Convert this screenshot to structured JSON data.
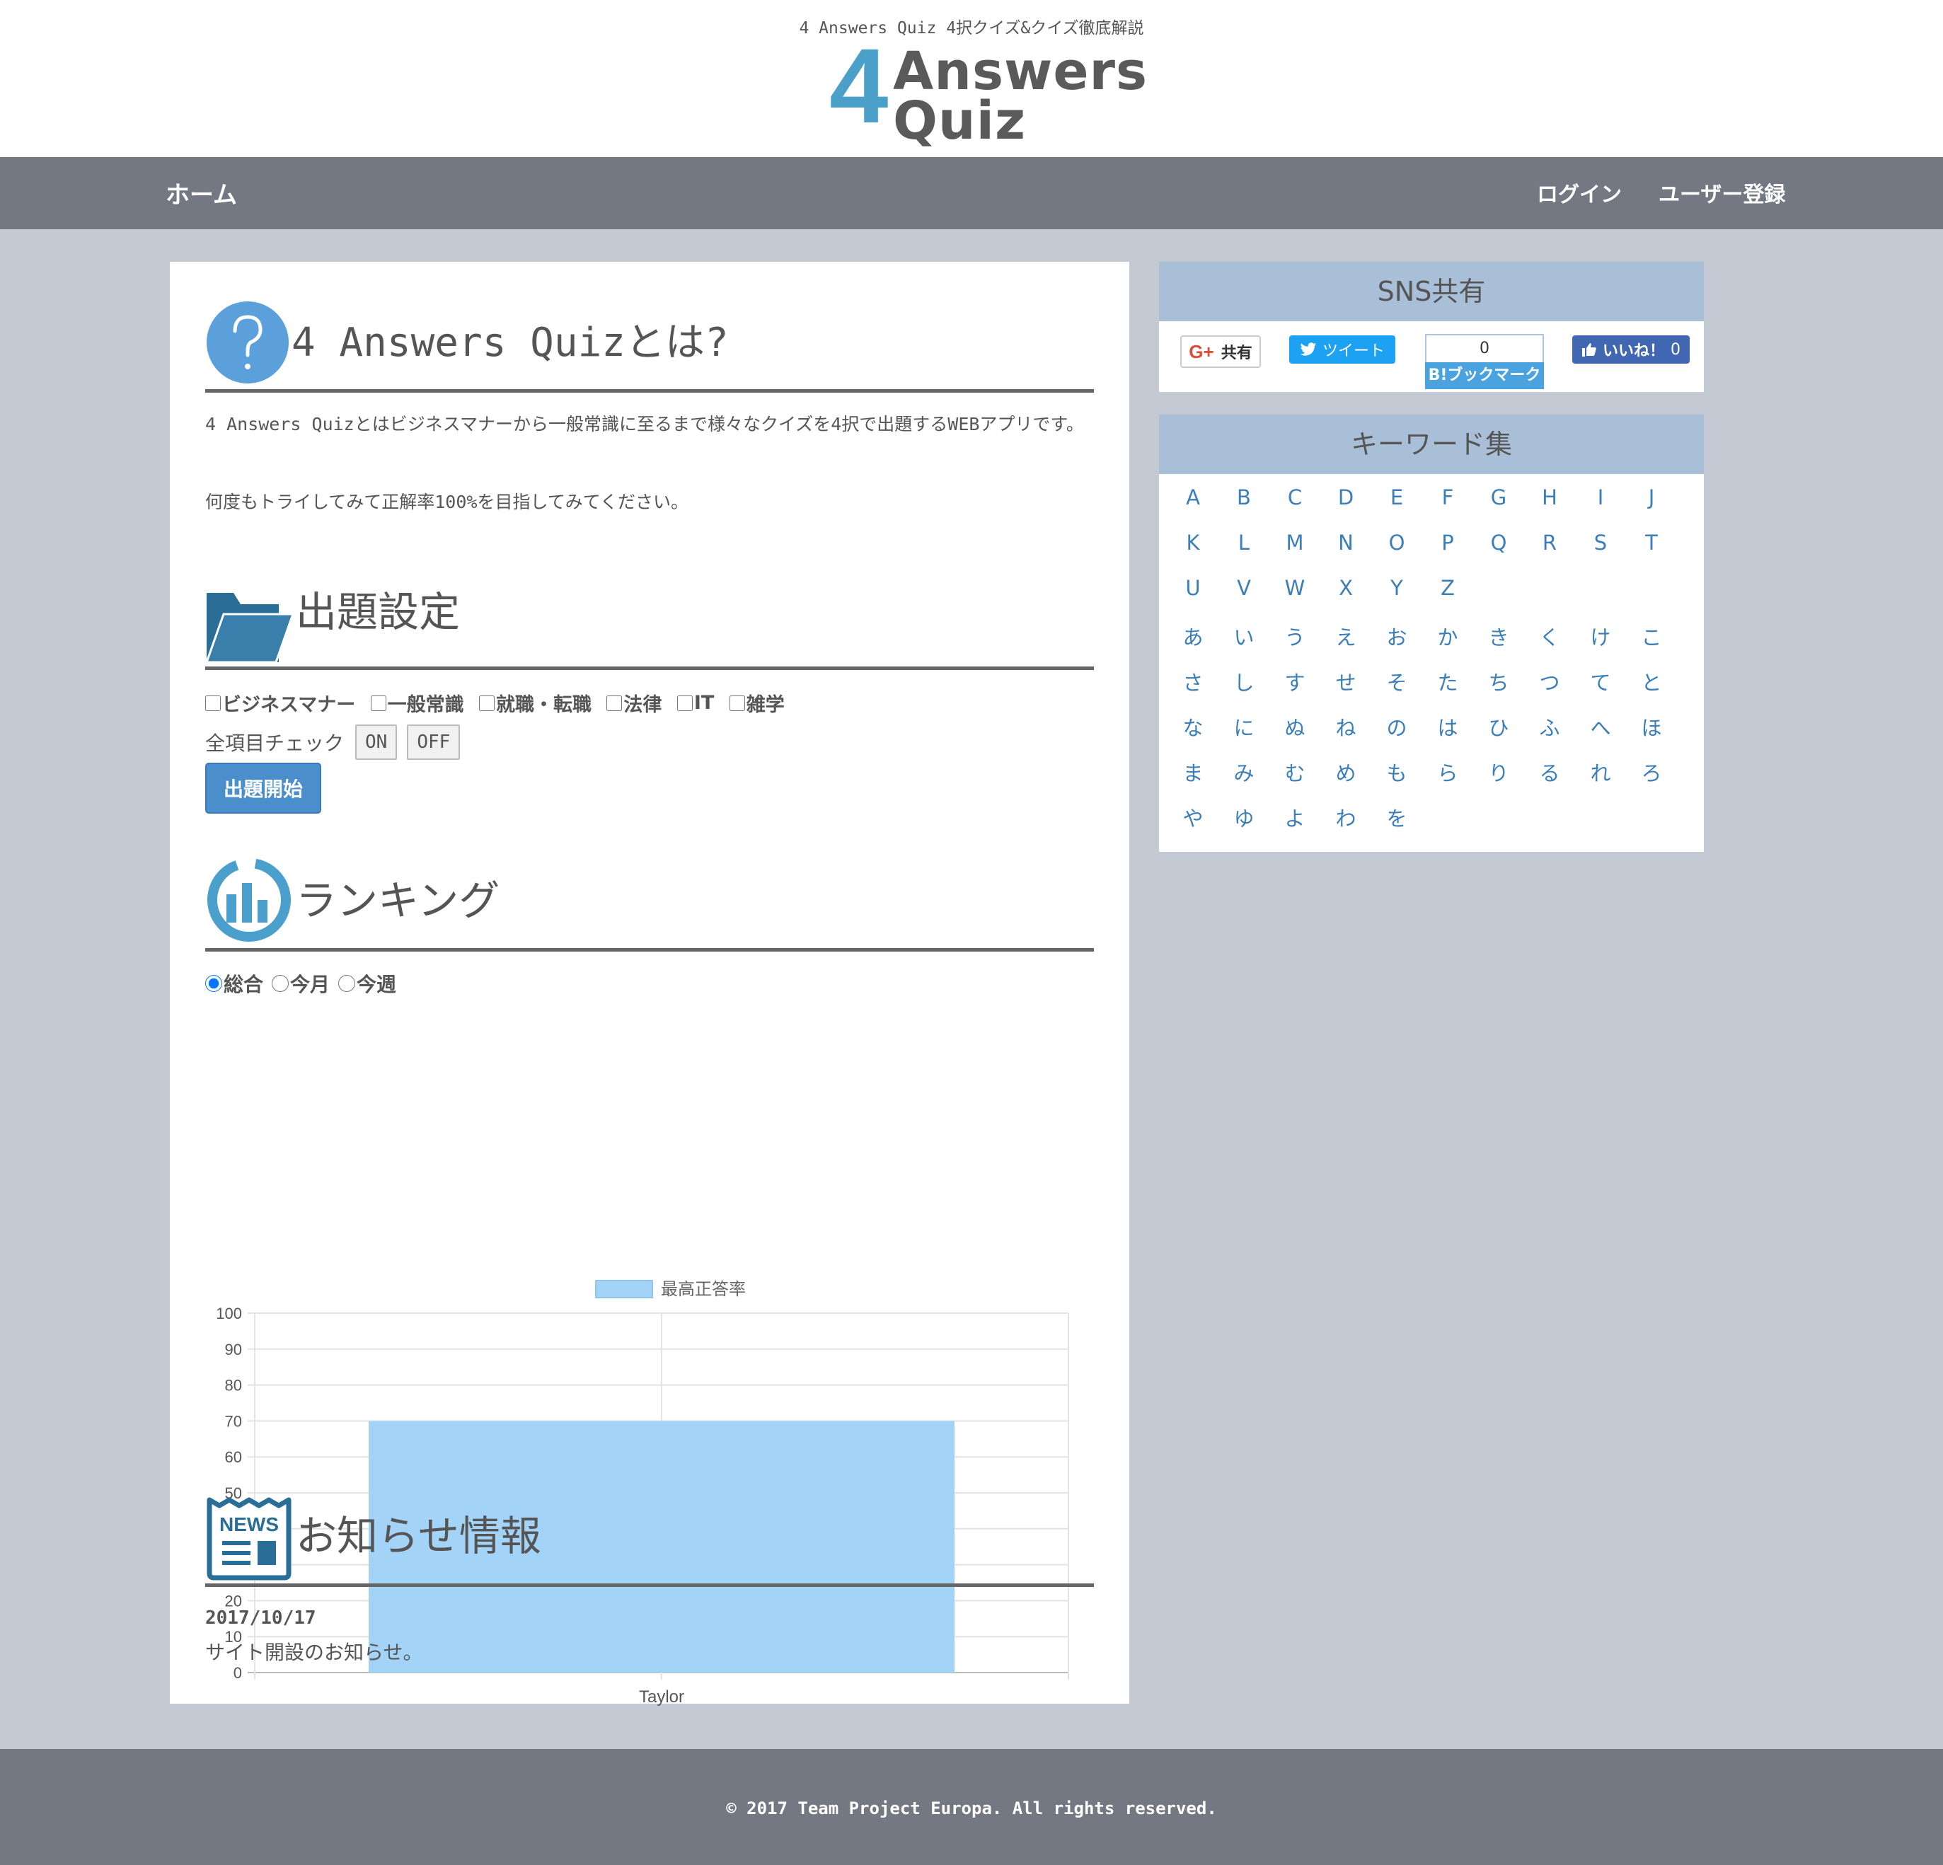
{
  "header": {
    "tagline": "4 Answers Quiz 4択クイズ&クイズ徹底解説",
    "logo_number": "4",
    "logo_word1": "Answers",
    "logo_word2": "Quiz"
  },
  "nav": {
    "home": "ホーム",
    "login": "ログイン",
    "register": "ユーザー登録"
  },
  "about": {
    "title": "4 Answers Quizとは?",
    "paragraph1": "4 Answers Quizとはビジネスマナーから一般常識に至るまで様々なクイズを4択で出題するWEBアプリです。",
    "paragraph2": "何度もトライしてみて正解率100%を目指してみてください。"
  },
  "settings": {
    "title": "出題設定",
    "categories": [
      "ビジネスマナー",
      "一般常識",
      "就職・転職",
      "法律",
      "IT",
      "雑学"
    ],
    "all_check_label": "全項目チェック",
    "on_label": "ON",
    "off_label": "OFF",
    "start_label": "出題開始"
  },
  "ranking": {
    "title": "ランキング",
    "periods": [
      {
        "label": "総合",
        "checked": true
      },
      {
        "label": "今月",
        "checked": false
      },
      {
        "label": "今週",
        "checked": false
      }
    ]
  },
  "chart_data": {
    "type": "bar",
    "categories": [
      "Taylor"
    ],
    "series": [
      {
        "name": "最高正答率",
        "values": [
          70
        ]
      }
    ],
    "ylim": [
      0,
      100
    ],
    "yticks": [
      0,
      10,
      20,
      30,
      40,
      50,
      60,
      70,
      80,
      90,
      100
    ],
    "legend": "top",
    "grid": true,
    "color": "#a3d4f7"
  },
  "news": {
    "title": "お知らせ情報",
    "icon_text": "NEWS",
    "date": "2017/10/17",
    "text": "サイト開設のお知らせ。"
  },
  "sns": {
    "title": "SNS共有",
    "google_label": "共有",
    "google_icon": "G+",
    "tweet_label": "ツイート",
    "hatena_count": "0",
    "hatena_label": "B!ブックマーク",
    "like_label": "いいね！",
    "like_count": "0"
  },
  "keywords": {
    "title": "キーワード集",
    "rows": [
      [
        "A",
        "B",
        "C",
        "D",
        "E",
        "F",
        "G",
        "H",
        "I",
        "J"
      ],
      [
        "K",
        "L",
        "M",
        "N",
        "O",
        "P",
        "Q",
        "R",
        "S",
        "T"
      ],
      [
        "U",
        "V",
        "W",
        "X",
        "Y",
        "Z"
      ],
      [
        "あ",
        "い",
        "う",
        "え",
        "お",
        "か",
        "き",
        "く",
        "け",
        "こ"
      ],
      [
        "さ",
        "し",
        "す",
        "せ",
        "そ",
        "た",
        "ち",
        "つ",
        "て",
        "と"
      ],
      [
        "な",
        "に",
        "ぬ",
        "ね",
        "の",
        "は",
        "ひ",
        "ふ",
        "へ",
        "ほ"
      ],
      [
        "ま",
        "み",
        "む",
        "め",
        "も",
        "ら",
        "り",
        "る",
        "れ",
        "ろ"
      ],
      [
        "や",
        "ゆ",
        "よ",
        "わ",
        "を"
      ]
    ]
  },
  "footer": {
    "copyright": "© 2017 Team Project Europa. All rights reserved."
  },
  "colors": {
    "nav_bg": "#737882",
    "page_bg": "#c3cad3",
    "side_head": "#a9bfd8",
    "accent_blue": "#4a8ecb",
    "logo_blue": "#4ba0c9"
  }
}
